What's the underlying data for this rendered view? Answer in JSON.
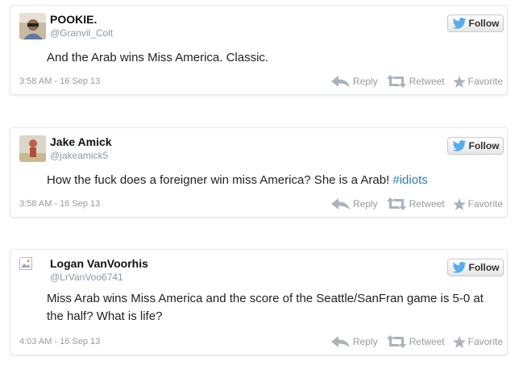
{
  "tweets": [
    {
      "name": "POOKIE.",
      "handle": "@Granvil_Colt",
      "text": "And the Arab wins Miss America. Classic.",
      "hashtag": "",
      "time": "3:58 AM - 16 Sep 13"
    },
    {
      "name": "Jake Amick",
      "handle": "@jakeamick5",
      "text": "How the fuck does a foreigner win miss America? She is a Arab! ",
      "hashtag": "#idiots",
      "time": "3:58 AM - 16 Sep 13"
    },
    {
      "name": "Logan VanVoorhis",
      "handle": "@LrVanVoo6741",
      "text": "Miss Arab wins Miss America and the score of the Seattle/SanFran game is 5-0 at the half? What is life?",
      "hashtag": "",
      "time": "4:03 AM - 16 Sep 13"
    }
  ],
  "labels": {
    "follow": "Follow",
    "reply": "Reply",
    "retweet": "Retweet",
    "favorite": "Favorite"
  },
  "colors": {
    "bird": "#55acee",
    "action_icon": "#aab3bb",
    "hashtag": "#2b7bb9"
  },
  "icons": [
    "twitter-bird-icon",
    "reply-icon",
    "retweet-icon",
    "favorite-star-icon",
    "broken-image-icon"
  ]
}
